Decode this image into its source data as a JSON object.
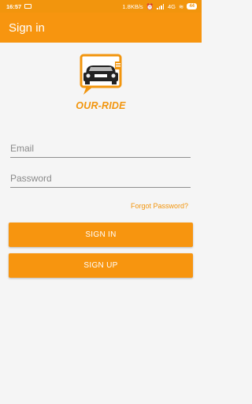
{
  "status_bar": {
    "time": "16:57",
    "network_speed": "1.8KB/s",
    "network_type": "4G",
    "battery": "44"
  },
  "appbar": {
    "title": "Sign in"
  },
  "logo": {
    "text": "OUR-RIDE",
    "accent_color": "#f2950d"
  },
  "form": {
    "email_placeholder": "Email",
    "password_placeholder": "Password",
    "forgot_label": "Forgot Password?"
  },
  "buttons": {
    "sign_in": "SIGN IN",
    "sign_up": "SIGN UP"
  },
  "colors": {
    "primary": "#f7950f",
    "background": "#f5f5f5"
  }
}
